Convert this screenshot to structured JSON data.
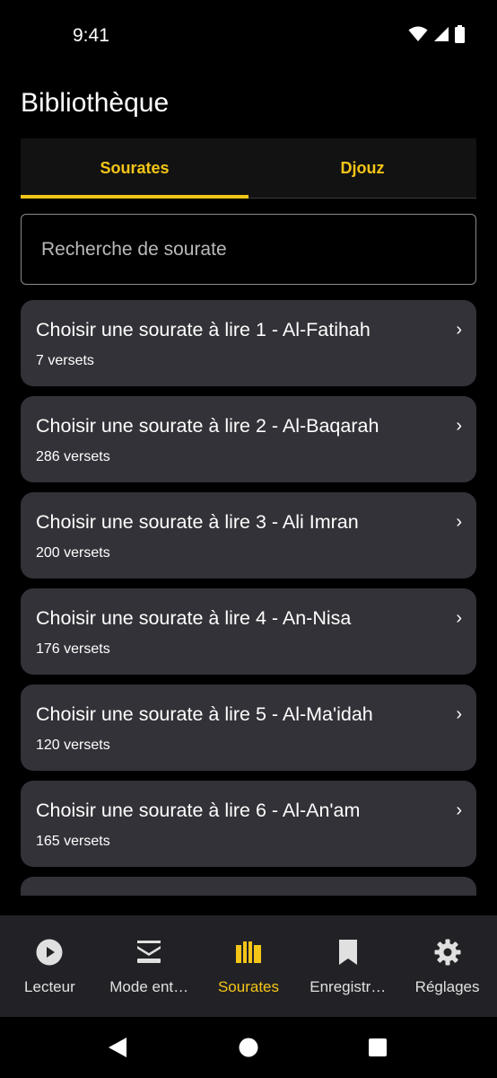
{
  "status": {
    "time": "9:41"
  },
  "header": {
    "title": "Bibliothèque"
  },
  "tabs": [
    {
      "label": "Sourates",
      "active": true
    },
    {
      "label": "Djouz",
      "active": false
    }
  ],
  "search": {
    "placeholder": "Recherche de sourate",
    "value": ""
  },
  "surahs": [
    {
      "title": "Choisir une sourate à lire 1 - Al-Fatihah",
      "verses": "7 versets"
    },
    {
      "title": "Choisir une sourate à lire 2 - Al-Baqarah",
      "verses": "286 versets"
    },
    {
      "title": "Choisir une sourate à lire 3 - Ali Imran",
      "verses": "200 versets"
    },
    {
      "title": "Choisir une sourate à lire 4 - An-Nisa",
      "verses": "176 versets"
    },
    {
      "title": "Choisir une sourate à lire 5 - Al-Ma'idah",
      "verses": "120 versets"
    },
    {
      "title": "Choisir une sourate à lire 6 - Al-An'am",
      "verses": "165 versets"
    }
  ],
  "chevron": "›",
  "bottom_nav": [
    {
      "label": "Lecteur",
      "icon": "play-circle-icon",
      "active": false
    },
    {
      "label": "Mode ent…",
      "icon": "layers-icon",
      "active": false
    },
    {
      "label": "Sourates",
      "icon": "library-icon",
      "active": true
    },
    {
      "label": "Enregistr…",
      "icon": "bookmark-icon",
      "active": false
    },
    {
      "label": "Réglages",
      "icon": "gear-icon",
      "active": false
    }
  ],
  "colors": {
    "accent": "#f5c518",
    "card": "#323238",
    "nav": "#222226",
    "background": "#000000"
  }
}
